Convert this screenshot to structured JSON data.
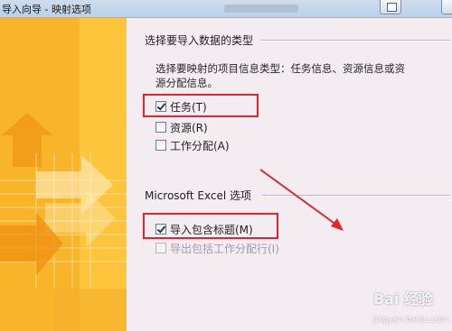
{
  "window": {
    "title": "导入向导 - 映射选项"
  },
  "section_type": {
    "title": "选择要导入数据的类型",
    "description": "选择要映射的项目信息类型：任务信息、资源信息或资源分配信息。",
    "options": [
      {
        "label": "任务(T)",
        "checked": true,
        "enabled": true
      },
      {
        "label": "资源(R)",
        "checked": false,
        "enabled": true
      },
      {
        "label": "工作分配(A)",
        "checked": false,
        "enabled": true
      }
    ]
  },
  "section_excel": {
    "title": "Microsoft Excel 选项",
    "options": [
      {
        "label": "导入包含标题(M)",
        "checked": true,
        "enabled": true
      },
      {
        "label": "导出包括工作分配行(I)",
        "checked": false,
        "enabled": false
      }
    ]
  },
  "watermark": {
    "text": "Bai 经验",
    "sub": "jingyan.baidu.com"
  },
  "colors": {
    "highlight": "#e2242f",
    "panel_orange": "#f6a920",
    "background": "#f3edf2"
  },
  "icons": {
    "help": "help-icon",
    "check": "checkmark-icon",
    "decor": "import-arrows-decoration"
  }
}
